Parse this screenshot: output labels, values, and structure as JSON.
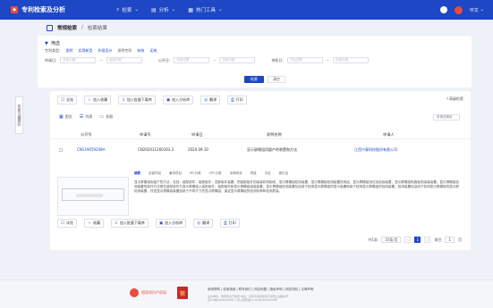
{
  "topbar": {
    "logo": "专利检索及分析",
    "nav": [
      {
        "icon": "search-icon",
        "label": "检索",
        "glyph": "⌕"
      },
      {
        "icon": "chart-icon",
        "label": "分析",
        "glyph": "▤"
      },
      {
        "icon": "hot-icon",
        "label": "热门工具",
        "glyph": "▦"
      }
    ],
    "lang": "中文"
  },
  "breadcrumb": {
    "current": "常规检索",
    "separator": "/",
    "page": "检索结果"
  },
  "filter": {
    "title": "筛选",
    "row1_label": "专利类型:",
    "chips": [
      "发明",
      "实用新型",
      "外观设计",
      "发明专利",
      "有效",
      "无效"
    ],
    "row2": {
      "app_date_label": "申请日:",
      "pub_date_label": "公开日:",
      "grant_date_label": "授权日:",
      "start_placeholder": "开始日期",
      "end_placeholder": "结束日期",
      "sep": "~"
    },
    "search_btn": "检索",
    "reset_btn": "清空"
  },
  "side_strip": "检索式编辑区",
  "toolbar": {
    "buttons": [
      {
        "icon": "list-icon",
        "label": "全选"
      },
      {
        "icon": "filter-icon",
        "label": "加入收藏"
      },
      {
        "icon": "download-icon",
        "label": "加入批量下载库"
      },
      {
        "icon": "analysis-icon",
        "label": "加入分析库"
      },
      {
        "icon": "trans-icon",
        "label": "翻译"
      },
      {
        "icon": "print-icon",
        "label": "打印"
      }
    ],
    "right_label": "↑高级检索"
  },
  "view": {
    "modes": [
      {
        "icon": "grid-icon",
        "label": "图文"
      },
      {
        "icon": "list-view-icon",
        "label": "列表"
      },
      {
        "icon": "table-icon",
        "label": "多图"
      }
    ],
    "sort": "申请日降序"
  },
  "table": {
    "headers": [
      "公开号",
      "申请号",
      "申请日",
      "发明名称",
      "申请人"
    ],
    "row": {
      "pubno": "CN119059208A",
      "appno": "CN202411260163.3",
      "appdate": "2024.09.10",
      "title": "显示屏模组用量产的装置和方法",
      "applicant": "江西兴泰科技股份有限公司"
    }
  },
  "detail_tabs": [
    "摘要",
    "全部内容",
    "著录项目",
    "IPC分类",
    "CPC分类",
    "法律状态",
    "同族",
    "引证",
    "被引证"
  ],
  "abstract": "显示屏模组用量产的方法，包括：装配部件，装配组件，顶部组件装置，把装配组件的组装机构制成，显示屏模组检测装置，显示屏模组检测装置的用途，显示屏模组测试及检验装置，显示屏模组电路板的组装装置。显示屏模组检测装置的制作方法是在装配部件与显示屏模组上装配组件，装配组件和显示屏模组组装装置。显示屏模组检测装置包括用于检测显示屏模组的显示装置和用于检测显示屏模组的检测装置，检测装置包括用于检测显示屏模组的显示屏检测装置，所述显示屏模组装置适用于不同尺寸的显示屏模组，保证显示屏模组的检测效率和检测质量。",
  "bottom_tools": [
    "详览",
    "收藏",
    "加入批量下载库",
    "加入分析库",
    "翻译",
    "打印"
  ],
  "pager": {
    "total": "共1条",
    "size": "10条/页",
    "pages": [
      "‹",
      "1",
      "›"
    ],
    "goto": "前往",
    "page": "1",
    "unit": "页"
  },
  "footer": {
    "logo1": "国家知识产权局",
    "badge": "徽",
    "links": "使用帮助 | 检索指南 | 联系我们 | 网站地图 | 隐私声明 | 网站导航 | 法律声明",
    "info1": "主办单位：国家知识产权局  地址：北京市海淀区蓟门桥西土城路6号",
    "info2": "京ICP备06062626号-1  京公网安备11010802008236号"
  }
}
